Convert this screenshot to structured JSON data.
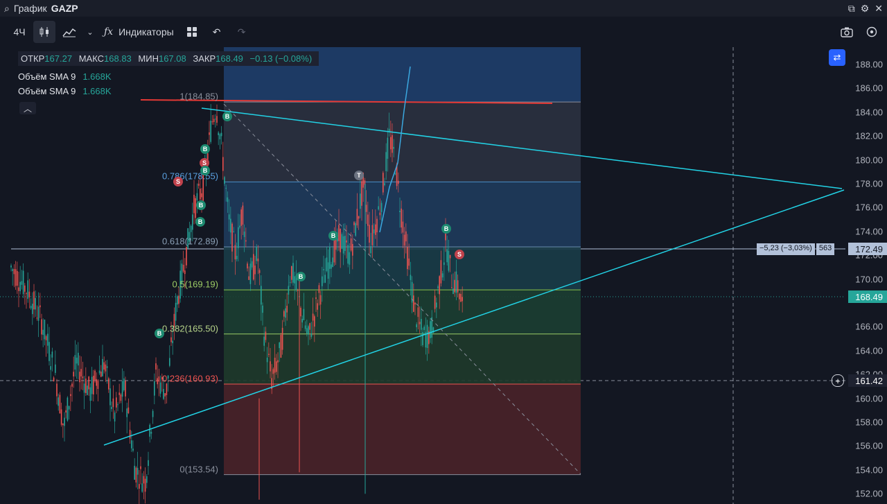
{
  "window": {
    "prefix": "График",
    "ticker": "GAZP"
  },
  "toolbar": {
    "interval": "4Ч",
    "indicators_label": "Индикаторы"
  },
  "legend": {
    "open_label": "ОТКР",
    "open": "167.27",
    "high_label": "МАКС",
    "high": "168.83",
    "low_label": "МИН",
    "low": "167.08",
    "close_label": "ЗАКР",
    "close": "168.49",
    "change": "−0.13 (−0.08%)",
    "sma1_label": "Объём SMA 9",
    "sma1": "1.668K",
    "sma2_label": "Объём SMA 9",
    "sma2": "1.668K"
  },
  "price_axis": {
    "ticks": [
      "188.00",
      "186.00",
      "184.00",
      "182.00",
      "180.00",
      "178.00",
      "176.00",
      "174.00",
      "172.00",
      "170.00",
      "166.00",
      "164.00",
      "162.00",
      "160.00",
      "158.00",
      "156.00",
      "154.00",
      "152.00"
    ],
    "current_price": "168.49",
    "line_price": "172.49",
    "crosshair_price": "161.42"
  },
  "fib_levels": [
    {
      "label": "1(184.85)",
      "price": 184.85
    },
    {
      "label": "0.786(178.55)",
      "price": 178.15
    },
    {
      "label": "0.618(172.89)",
      "price": 172.7
    },
    {
      "label": "0.5(169.19)",
      "price": 169.1
    },
    {
      "label": "0.382(165.50)",
      "price": 165.4
    },
    {
      "label": "0.236(160.93)",
      "price": 161.2
    },
    {
      "label": "0(153.54)",
      "price": 153.6
    }
  ],
  "measure": {
    "delta": "−5,23 (−3,03%)",
    "bars": "563"
  },
  "colors": {
    "up": "#26a69a",
    "down": "#ef5350",
    "bg": "#131722",
    "accent": "#2962ff",
    "trend": "#22d3e6"
  }
}
